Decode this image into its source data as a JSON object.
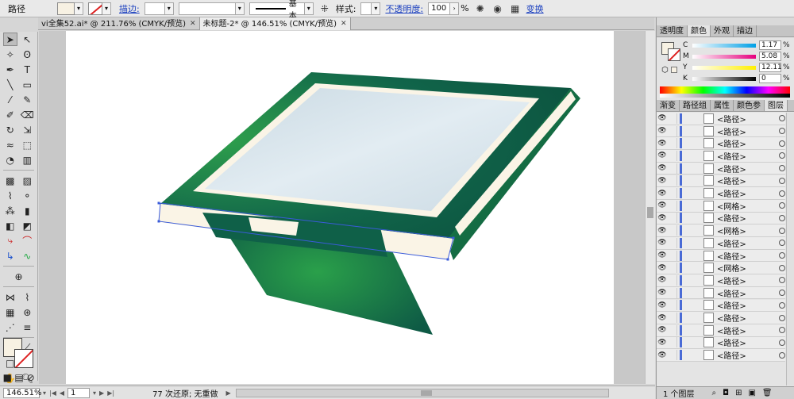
{
  "control_bar": {
    "object_type": "路径",
    "stroke_label": "描边:",
    "stroke_profile": "基本",
    "style_label": "样式:",
    "opacity_label": "不透明度:",
    "opacity_value": "100",
    "opacity_unit": "%",
    "transform_label": "变换"
  },
  "tabs": [
    {
      "label": "vi全集52.ai* @ 211.76% (CMYK/预览)",
      "active": false
    },
    {
      "label": "未标题-2* @ 146.51% (CMYK/预览)",
      "active": true
    }
  ],
  "tab_close_glyph": "✕",
  "status_bar": {
    "zoom": "146.51%",
    "page": "1",
    "undo_status": "77 次还原; 无重做"
  },
  "color_panel": {
    "tabs": [
      "透明度",
      "颜色",
      "外观",
      "描边"
    ],
    "active_tab": "颜色",
    "channels": [
      {
        "label": "C",
        "value": "1.17",
        "unit": "%",
        "gradient_from": "#ffffff",
        "gradient_to": "#00a0e6"
      },
      {
        "label": "M",
        "value": "5.08",
        "unit": "%",
        "gradient_from": "#ffffff",
        "gradient_to": "#e6007e"
      },
      {
        "label": "Y",
        "value": "12.11",
        "unit": "%",
        "gradient_from": "#ffffff",
        "gradient_to": "#fff000"
      },
      {
        "label": "K",
        "value": "0",
        "unit": "%",
        "gradient_from": "#ffffff",
        "gradient_to": "#000000"
      }
    ],
    "fill_color": "#f7f1e3"
  },
  "layers_panel": {
    "tabs": [
      "渐变",
      "路径组",
      "属性",
      "颜色参",
      "图层"
    ],
    "active_tab": "图层",
    "items": [
      {
        "name": "<路径>"
      },
      {
        "name": "<路径>"
      },
      {
        "name": "<路径>"
      },
      {
        "name": "<路径>"
      },
      {
        "name": "<路径>"
      },
      {
        "name": "<路径>"
      },
      {
        "name": "<路径>"
      },
      {
        "name": "<网格>"
      },
      {
        "name": "<路径>"
      },
      {
        "name": "<网格>"
      },
      {
        "name": "<路径>"
      },
      {
        "name": "<路径>"
      },
      {
        "name": "<网格>"
      },
      {
        "name": "<路径>"
      },
      {
        "name": "<路径>"
      },
      {
        "name": "<路径>"
      },
      {
        "name": "<路径>"
      },
      {
        "name": "<路径>"
      },
      {
        "name": "<路径>"
      },
      {
        "name": "<路径>"
      }
    ],
    "footer_label": "1 个图层"
  },
  "colors": {
    "accent_link": "#1a3fbf",
    "kiosk_green_dark": "#0e5a45",
    "kiosk_green_bright": "#2aa04a",
    "kiosk_cream": "#faf4e6",
    "screen_light": "#dfe9ef",
    "selection_blue": "#3a5bd9"
  }
}
